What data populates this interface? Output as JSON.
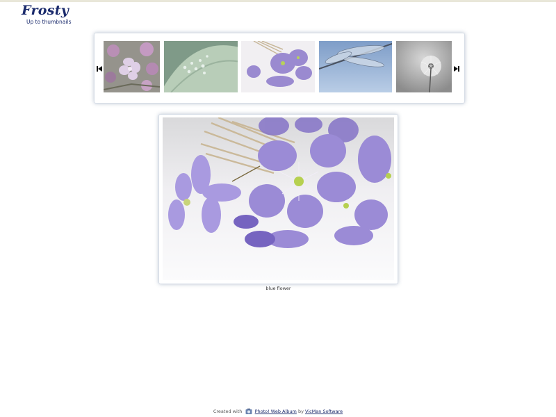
{
  "site": {
    "title": "Frosty",
    "up_link": "Up to thumbnails"
  },
  "thumbnails": [
    {
      "name": "lilac"
    },
    {
      "name": "leaf with water drops"
    },
    {
      "name": "blue flower"
    },
    {
      "name": "dragonfly"
    },
    {
      "name": "dandelion"
    }
  ],
  "nav": {
    "prev_icon": "skip-previous-icon",
    "next_icon": "skip-next-icon"
  },
  "main_image": {
    "caption": "blue flower"
  },
  "footer": {
    "created_with": "Created with",
    "app_link": "Photo! Web Album",
    "by": "by",
    "vendor_link": "VicMan Software"
  }
}
